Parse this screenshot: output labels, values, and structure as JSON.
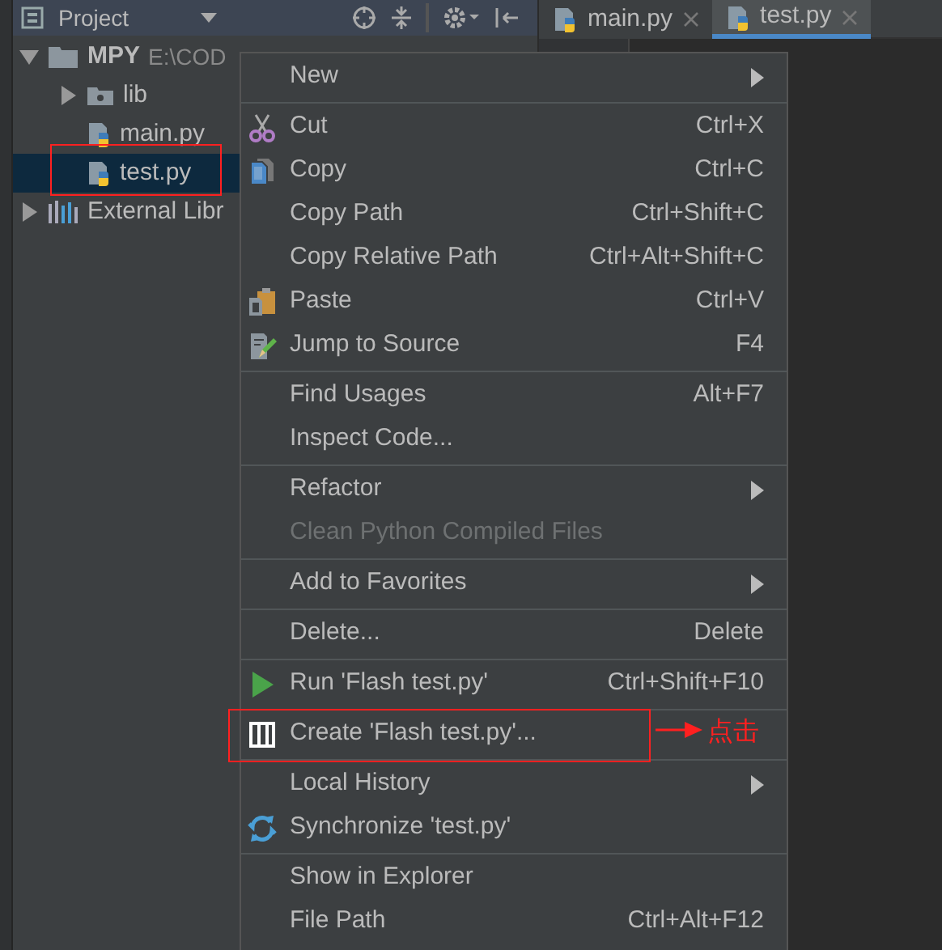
{
  "project_panel": {
    "title": "Project",
    "tree": [
      {
        "label": "MPY",
        "path": "E:\\COD",
        "expanded": true,
        "selected": false,
        "children": [
          {
            "label": "lib",
            "expanded": false,
            "selected": false,
            "kind": "folder"
          },
          {
            "label": "main.py",
            "selected": false,
            "kind": "python"
          },
          {
            "label": "test.py",
            "selected": true,
            "kind": "python"
          }
        ]
      },
      {
        "label": "External Libr",
        "expanded": false,
        "selected": false,
        "kind": "libraries"
      }
    ]
  },
  "editor_tabs": [
    {
      "label": "main.py",
      "selected": false
    },
    {
      "label": "test.py",
      "selected": true
    }
  ],
  "context_menu": [
    {
      "kind": "item",
      "label": "New",
      "submenu": true,
      "disabled": false
    },
    {
      "kind": "separator"
    },
    {
      "kind": "item",
      "label": "Cut",
      "shortcut": "Ctrl+X",
      "submenu": false,
      "disabled": false
    },
    {
      "kind": "item",
      "label": "Copy",
      "shortcut": "Ctrl+C",
      "submenu": false,
      "disabled": false
    },
    {
      "kind": "item",
      "label": "Copy Path",
      "shortcut": "Ctrl+Shift+C",
      "submenu": false,
      "disabled": false
    },
    {
      "kind": "item",
      "label": "Copy Relative Path",
      "shortcut": "Ctrl+Alt+Shift+C",
      "submenu": false,
      "disabled": false
    },
    {
      "kind": "item",
      "label": "Paste",
      "shortcut": "Ctrl+V",
      "submenu": false,
      "disabled": false
    },
    {
      "kind": "item",
      "label": "Jump to Source",
      "shortcut": "F4",
      "submenu": false,
      "disabled": false
    },
    {
      "kind": "separator"
    },
    {
      "kind": "item",
      "label": "Find Usages",
      "shortcut": "Alt+F7",
      "submenu": false,
      "disabled": false
    },
    {
      "kind": "item",
      "label": "Inspect Code...",
      "submenu": false,
      "disabled": false
    },
    {
      "kind": "separator"
    },
    {
      "kind": "item",
      "label": "Refactor",
      "submenu": true,
      "disabled": false
    },
    {
      "kind": "item",
      "label": "Clean Python Compiled Files",
      "submenu": false,
      "disabled": true
    },
    {
      "kind": "separator"
    },
    {
      "kind": "item",
      "label": "Add to Favorites",
      "submenu": true,
      "disabled": false
    },
    {
      "kind": "separator"
    },
    {
      "kind": "item",
      "label": "Delete...",
      "shortcut": "Delete",
      "submenu": false,
      "disabled": false
    },
    {
      "kind": "separator"
    },
    {
      "kind": "item",
      "label": "Run 'Flash test.py'",
      "shortcut": "Ctrl+Shift+F10",
      "submenu": false,
      "disabled": false
    },
    {
      "kind": "separator"
    },
    {
      "kind": "item",
      "label": "Create 'Flash test.py'...",
      "submenu": false,
      "disabled": false
    },
    {
      "kind": "separator"
    },
    {
      "kind": "item",
      "label": "Local History",
      "submenu": true,
      "disabled": false
    },
    {
      "kind": "item",
      "label": "Synchronize 'test.py'",
      "submenu": false,
      "disabled": false
    },
    {
      "kind": "separator"
    },
    {
      "kind": "item",
      "label": "Show in Explorer",
      "submenu": false,
      "disabled": false
    },
    {
      "kind": "item",
      "label": "File Path",
      "shortcut": "Ctrl+Alt+F12",
      "submenu": false,
      "disabled": false
    }
  ],
  "annotation": {
    "text": "点击"
  }
}
